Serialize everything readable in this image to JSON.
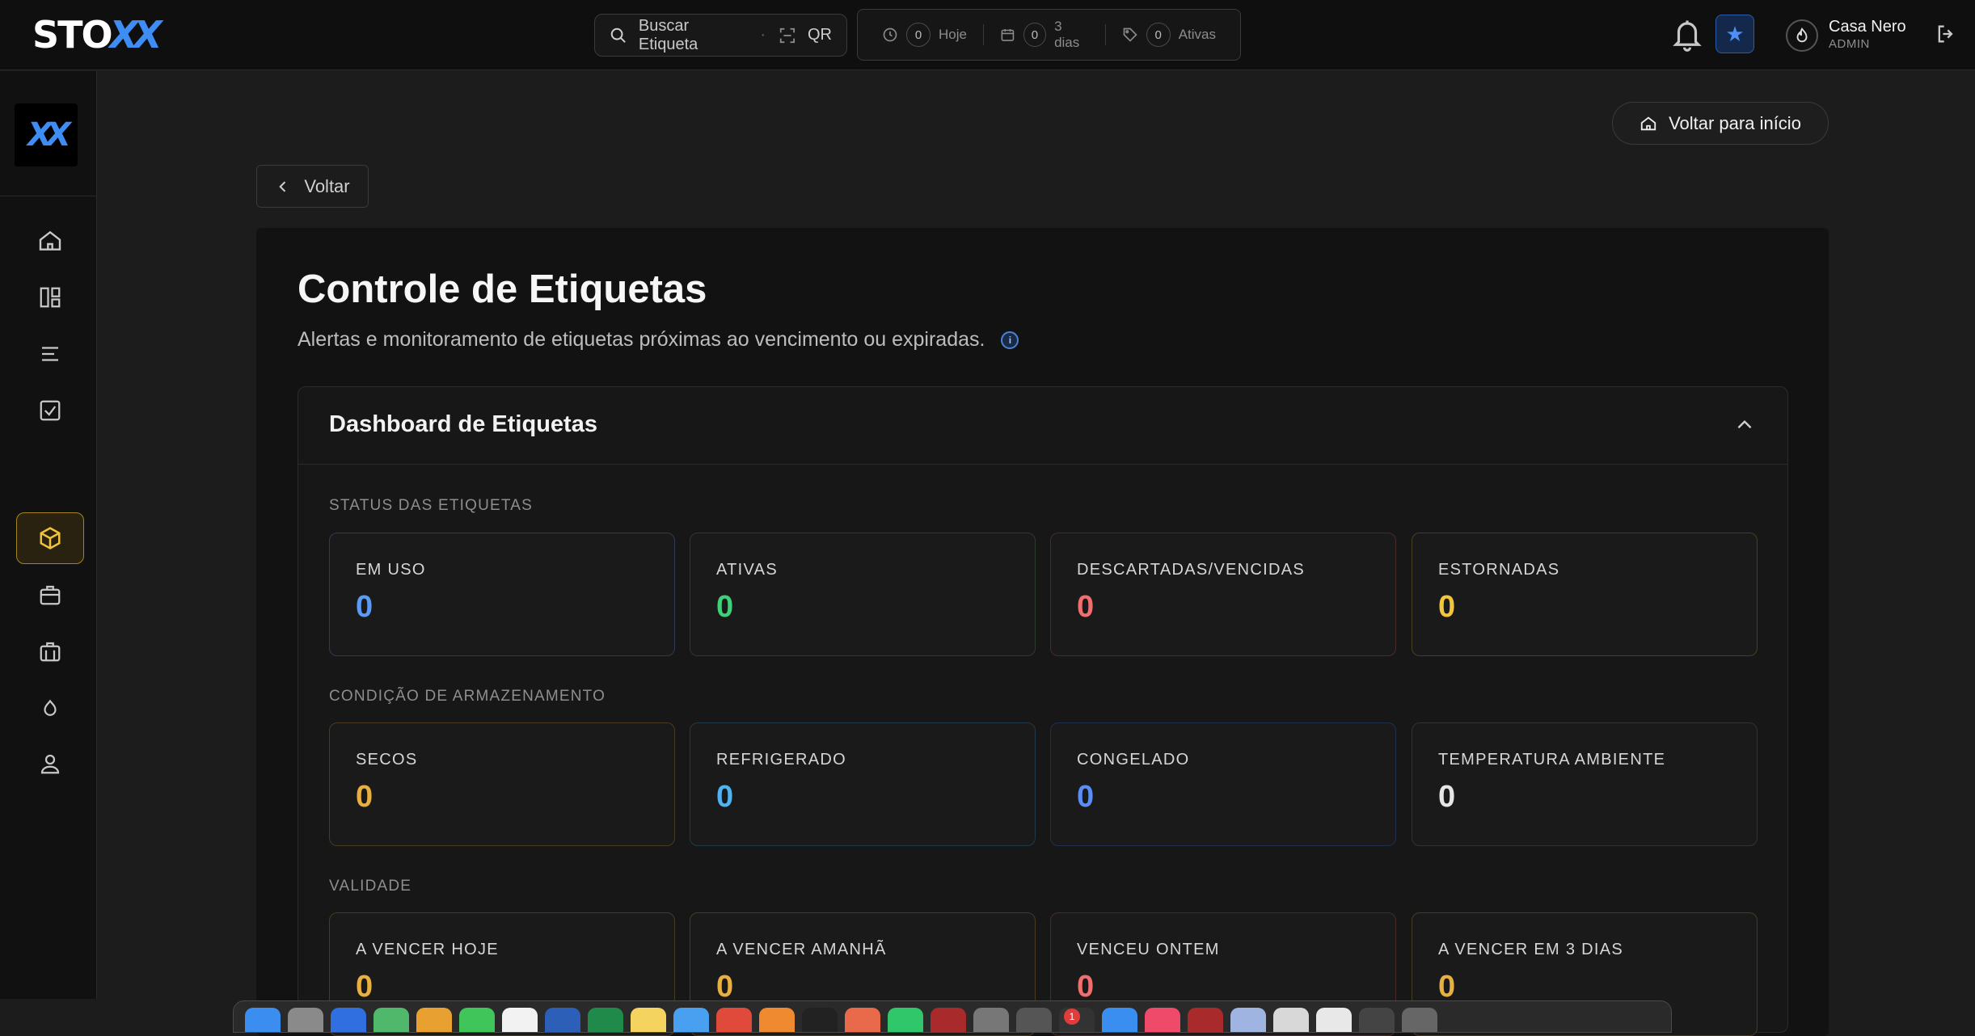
{
  "brand": {
    "logo_main": "STO",
    "logo_accent": "XX",
    "sidebar_logo": "XX"
  },
  "header": {
    "search_placeholder": "Buscar Etiqueta",
    "search_separator": "·",
    "qr_label": "QR",
    "stats": [
      {
        "count": "0",
        "label": "Hoje",
        "icon": "clock-icon"
      },
      {
        "count": "0",
        "label": "3 dias",
        "icon": "calendar-icon"
      },
      {
        "count": "0",
        "label": "Ativas",
        "icon": "tag-icon"
      }
    ],
    "star_glyph": "★",
    "user": {
      "name": "Casa Nero",
      "role": "ADMIN"
    }
  },
  "sidebar": {
    "items": [
      {
        "name": "home",
        "icon": "home-icon",
        "active": false
      },
      {
        "name": "dashboard",
        "icon": "grid-icon",
        "active": false
      },
      {
        "name": "list",
        "icon": "list-icon",
        "active": false
      },
      {
        "name": "tasks",
        "icon": "checkbox-icon",
        "active": false
      },
      {
        "name": "products",
        "icon": "box-icon",
        "active": true
      },
      {
        "name": "inventory",
        "icon": "briefcase-icon",
        "active": false
      },
      {
        "name": "storage",
        "icon": "briefcase-alt-icon",
        "active": false
      },
      {
        "name": "temperature",
        "icon": "droplet-icon",
        "active": false
      },
      {
        "name": "users",
        "icon": "user-icon",
        "active": false
      }
    ]
  },
  "main": {
    "home_button": "Voltar para início",
    "back_button": "Voltar",
    "title": "Controle de Etiquetas",
    "subtitle": "Alertas e monitoramento de etiquetas próximas ao vencimento ou expiradas.",
    "info_glyph": "i"
  },
  "dashboard": {
    "title": "Dashboard de Etiquetas",
    "sections": [
      {
        "label": "STATUS DAS ETIQUETAS",
        "cards": [
          {
            "label": "EM USO",
            "value": "0",
            "color": "#5b9bf2"
          },
          {
            "label": "ATIVAS",
            "value": "0",
            "color": "#3fd07a"
          },
          {
            "label": "DESCARTADAS/VENCIDAS",
            "value": "0",
            "color": "#ef6f6f"
          },
          {
            "label": "ESTORNADAS",
            "value": "0",
            "color": "#f3c53a"
          }
        ]
      },
      {
        "label": "CONDIÇÃO DE ARMAZENAMENTO",
        "cards": [
          {
            "label": "SECOS",
            "value": "0",
            "color": "#e8b040"
          },
          {
            "label": "REFRIGERADO",
            "value": "0",
            "color": "#4fb3f0"
          },
          {
            "label": "CONGELADO",
            "value": "0",
            "color": "#5b8df5"
          },
          {
            "label": "TEMPERATURA AMBIENTE",
            "value": "0",
            "color": "#e6e6e6"
          }
        ]
      },
      {
        "label": "VALIDADE",
        "cards": [
          {
            "label": "A VENCER HOJE",
            "value": "0",
            "color": "#e8b040"
          },
          {
            "label": "A VENCER AMANHÃ",
            "value": "0",
            "color": "#e8b040"
          },
          {
            "label": "VENCEU ONTEM",
            "value": "0",
            "color": "#ef6f6f"
          },
          {
            "label": "A VENCER EM 3 DIAS",
            "value": "0",
            "color": "#e8b040"
          }
        ]
      }
    ]
  },
  "dock": {
    "badge_count": "1"
  }
}
